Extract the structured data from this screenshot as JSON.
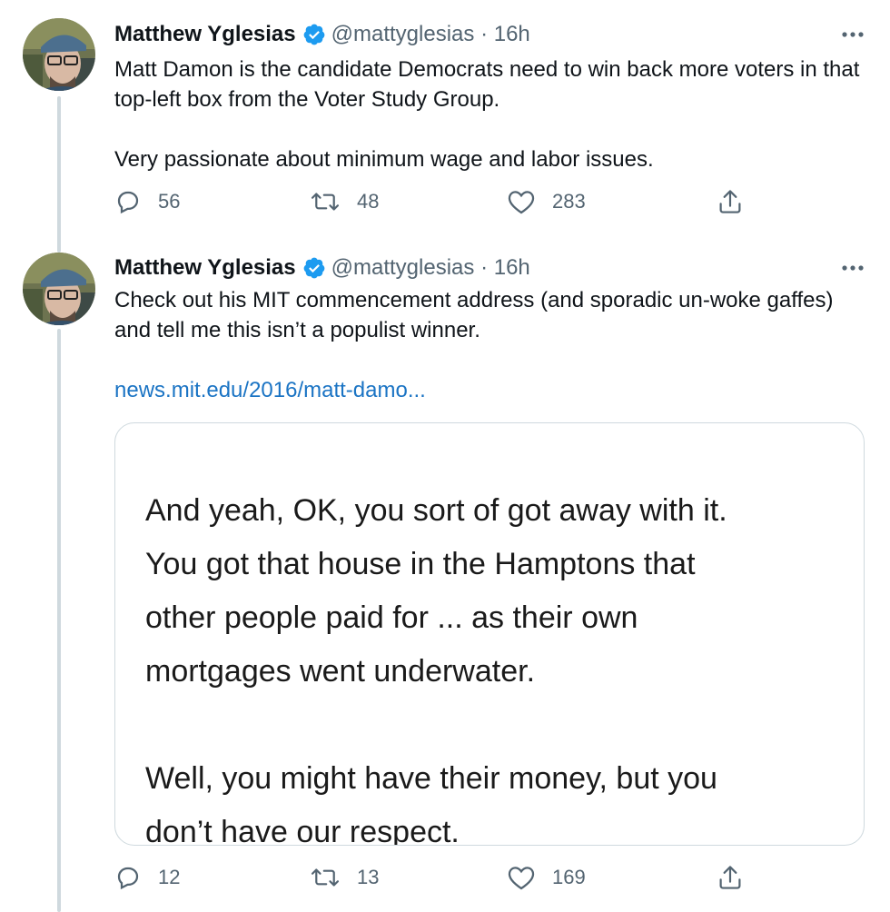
{
  "tweets": [
    {
      "author_name": "Matthew Yglesias",
      "handle": "@mattyglesias",
      "separator": "·",
      "time": "16h",
      "text": "Matt Damon is the candidate Democrats need to win back more voters in that top-left box from the Voter Study Group.\n\nVery passionate about minimum wage and labor issues.",
      "replies": "56",
      "retweets": "48",
      "likes": "283"
    },
    {
      "author_name": "Matthew Yglesias",
      "handle": "@mattyglesias",
      "separator": "·",
      "time": "16h",
      "text": "Check out his MIT commencement address (and sporadic un-woke gaffes) and tell me this isn’t a populist winner.",
      "link": "news.mit.edu/2016/matt-damo...",
      "card_text": "And yeah, OK, you sort of got away with it.\nYou got that house in the Hamptons that\nother people paid for ... as their own\nmortgages went underwater.\n\nWell, you might have their money, but you\ndon’t have our respect.",
      "replies": "12",
      "retweets": "13",
      "likes": "169"
    }
  ],
  "icons": {
    "verified": "verified-badge-icon",
    "more": "more-options-icon",
    "reply": "reply-icon",
    "retweet": "retweet-icon",
    "like": "like-icon",
    "share": "share-icon"
  },
  "colors": {
    "verified": "#1d9bf0",
    "link": "#1b74c4",
    "muted": "#536471",
    "thread_line": "#cfd9de"
  }
}
